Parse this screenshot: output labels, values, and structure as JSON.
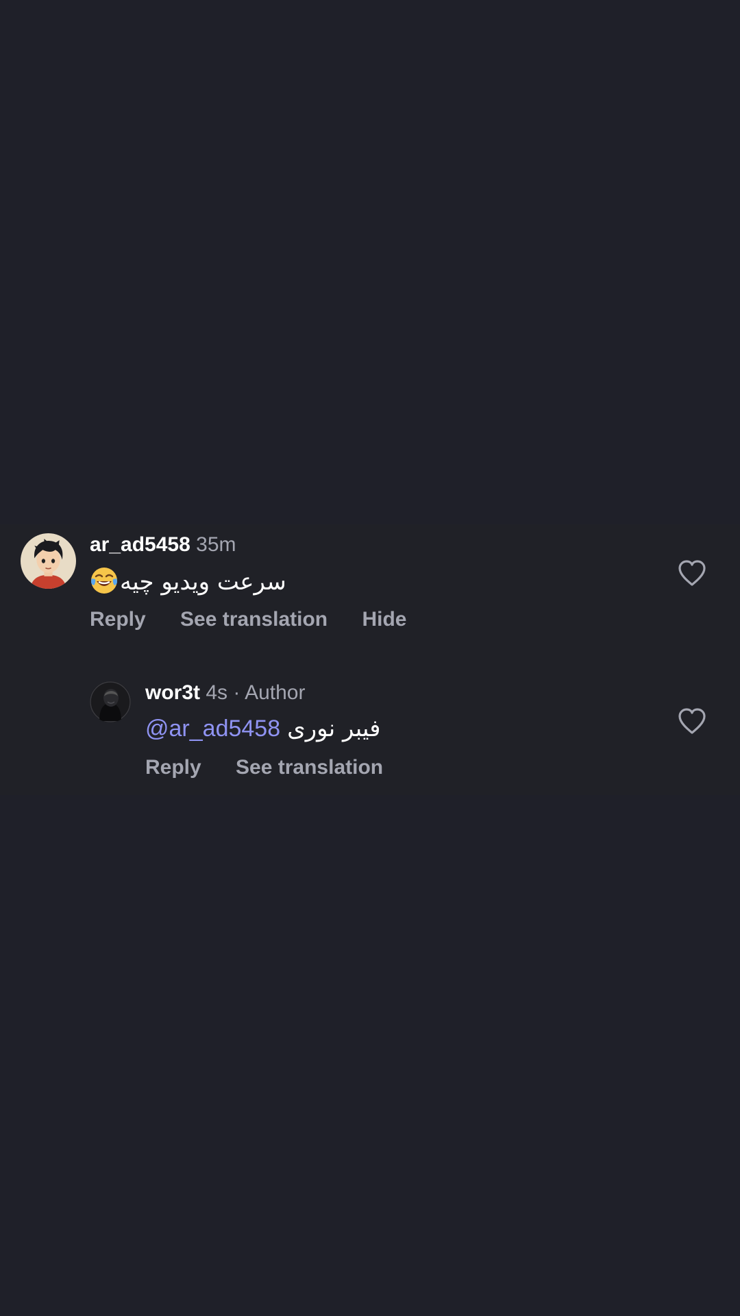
{
  "comment": {
    "username": "ar_ad5458",
    "time": "35m",
    "emoji_icon": "face-with-tears-of-joy",
    "text": "سرعت ویدیو چیه",
    "actions": {
      "reply": "Reply",
      "see_translation": "See translation",
      "hide": "Hide"
    }
  },
  "reply": {
    "username": "wor3t",
    "time": "4s",
    "separator": "·",
    "badge": "Author",
    "mention": "@ar_ad5458",
    "text": "فیبر نوری",
    "actions": {
      "reply": "Reply",
      "see_translation": "See translation"
    }
  },
  "colors": {
    "background": "#1f2029",
    "thread_background": "#202127",
    "muted_text": "#a4a6b1",
    "mention": "#8f93f2"
  }
}
